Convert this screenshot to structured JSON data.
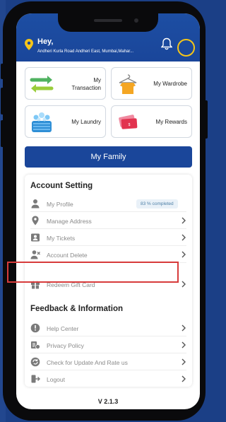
{
  "header": {
    "greeting": "Hey,",
    "address": "Andheri Kurla Road Andheri East, Mumbai,Mahar..."
  },
  "tiles": [
    {
      "label": "My\nTransaction",
      "icon": "transaction-icon"
    },
    {
      "label": "My Wardrobe",
      "icon": "wardrobe-icon"
    },
    {
      "label": "My Laundry",
      "icon": "laundry-icon"
    },
    {
      "label": "My Rewards",
      "icon": "rewards-icon"
    }
  ],
  "family_button": "My Family",
  "account": {
    "title": "Account Setting",
    "items": [
      {
        "label": "My Profile",
        "icon": "person-icon",
        "badge": "83 % completed"
      },
      {
        "label": "Manage Address",
        "icon": "location-icon"
      },
      {
        "label": "My Tickets",
        "icon": "ticket-icon"
      },
      {
        "label": "Account Delete",
        "icon": "user-delete-icon"
      },
      {
        "label": "Redeem Gift Card",
        "icon": "gift-icon"
      }
    ]
  },
  "feedback": {
    "title": "Feedback & Information",
    "items": [
      {
        "label": "Help Center",
        "icon": "info-icon"
      },
      {
        "label": "Privacy Policy",
        "icon": "policy-icon"
      },
      {
        "label": "Check for Update And Rate us",
        "icon": "update-icon"
      },
      {
        "label": "Logout",
        "icon": "logout-icon"
      }
    ]
  },
  "version": "V 2.1.3",
  "colors": {
    "brand": "#1a469a",
    "accent": "#f5c518",
    "highlight": "#d73b3b"
  }
}
